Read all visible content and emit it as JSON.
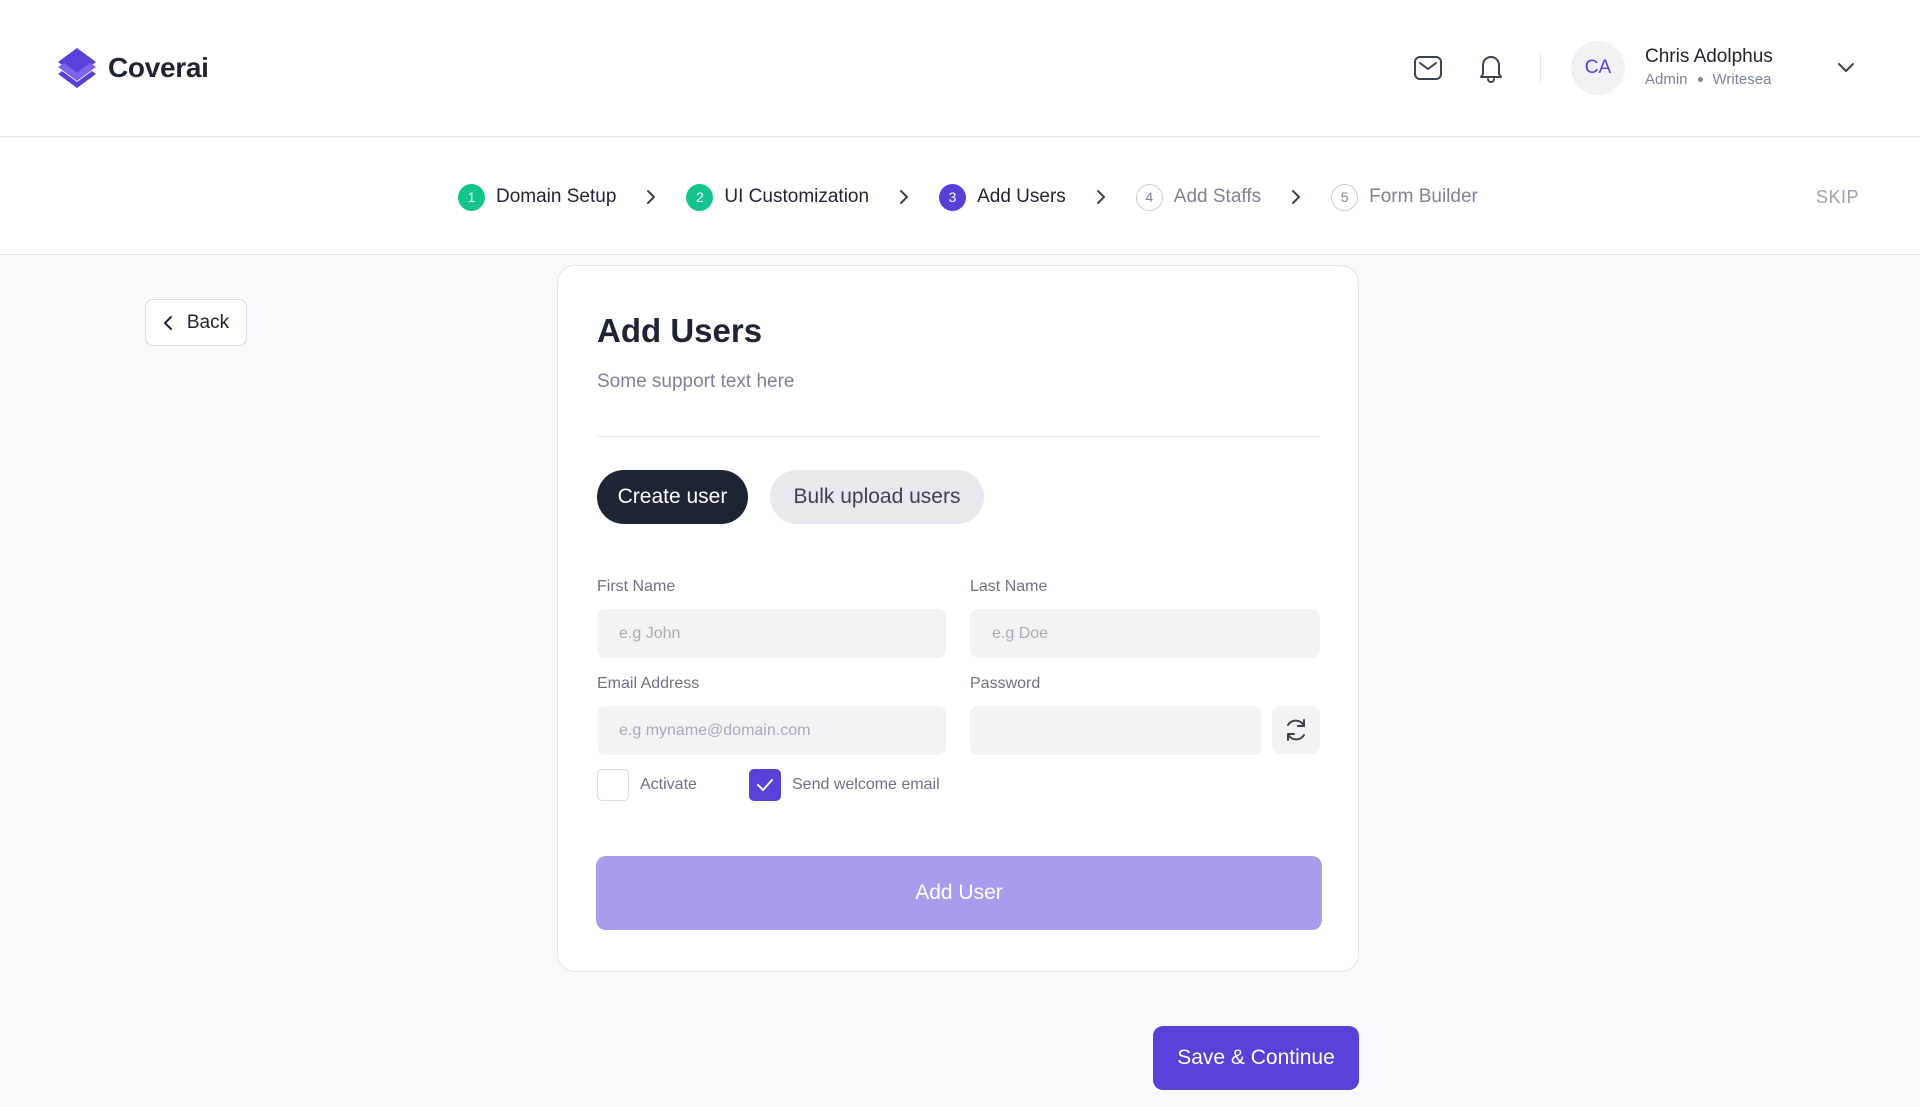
{
  "app": {
    "name": "Coverai",
    "brand_color": "#5b3fd9"
  },
  "header": {
    "icons": [
      "mail-icon",
      "bell-icon"
    ],
    "user": {
      "initials": "CA",
      "name": "Chris Adolphus",
      "role": "Admin",
      "org": "Writesea"
    }
  },
  "stepper": {
    "steps": [
      {
        "number": "1",
        "label": "Domain Setup",
        "status": "done"
      },
      {
        "number": "2",
        "label": "UI Customization",
        "status": "done"
      },
      {
        "number": "3",
        "label": "Add Users",
        "status": "active"
      },
      {
        "number": "4",
        "label": "Add Staffs",
        "status": "todo"
      },
      {
        "number": "5",
        "label": "Form Builder",
        "status": "todo"
      }
    ],
    "skip_label": "SKIP"
  },
  "nav": {
    "back_label": "Back"
  },
  "card": {
    "title": "Add Users",
    "subtitle": "Some support text here",
    "tabs": [
      {
        "label": "Create user",
        "selected": true
      },
      {
        "label": "Bulk upload users",
        "selected": false
      }
    ],
    "form": {
      "first_name": {
        "label": "First Name",
        "placeholder": "e.g John",
        "value": ""
      },
      "last_name": {
        "label": "Last Name",
        "placeholder": "e.g Doe",
        "value": ""
      },
      "email": {
        "label": "Email Address",
        "placeholder": "e.g myname@domain.com",
        "value": ""
      },
      "password": {
        "label": "Password",
        "placeholder": "",
        "value": ""
      },
      "activate": {
        "label": "Activate",
        "checked": false
      },
      "send_welcome": {
        "label": "Send welcome email",
        "checked": true
      }
    },
    "submit_label": "Add User"
  },
  "footer": {
    "save_label": "Save & Continue"
  }
}
